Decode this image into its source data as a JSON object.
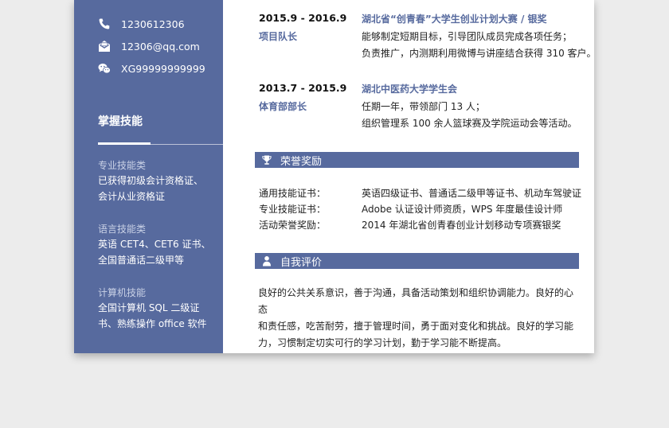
{
  "sidebar": {
    "contacts": [
      {
        "icon": "phone-icon",
        "text": "1230612306"
      },
      {
        "icon": "email-icon",
        "text": "12306@qq.com"
      },
      {
        "icon": "wechat-icon",
        "text": "XG99999999999"
      }
    ],
    "skills_title": "掌握技能",
    "skills": [
      {
        "category": "专业技能类",
        "lines": [
          "已获得初级会计资格证、",
          "会计从业资格证"
        ]
      },
      {
        "category": "语言技能类",
        "lines": [
          "英语 CET4、CET6 证书、",
          "全国普通话二级甲等"
        ]
      },
      {
        "category": "计算机技能",
        "lines": [
          "全国计算机 SQL 二级证",
          "书、熟练操作 office 软件"
        ]
      }
    ]
  },
  "experience": [
    {
      "date": "2015.9 - 2016.9",
      "role": "项目队长",
      "org": "湖北省“创青春”大学生创业计划大赛 / 银奖",
      "lines": [
        "能够制定短期目标，引导团队成员完成各项任务；",
        "负责推广，内测期利用微博与讲座结合获得 310 客户。"
      ]
    },
    {
      "date": "2013.7 - 2015.9",
      "role": "体育部部长",
      "org": "湖北中医药大学学生会",
      "lines": [
        "任期一年，带领部门 13 人；",
        "组织管理系 100 余人篮球赛及学院运动会等活动。"
      ]
    }
  ],
  "honors": {
    "title": "荣誉奖励",
    "items": [
      {
        "label": "通用技能证书：",
        "value": "英语四级证书、普通话二级甲等证书、机动车驾驶证"
      },
      {
        "label": "专业技能证书：",
        "value": "Adobe 认证设计师资质，WPS 年度最佳设计师"
      },
      {
        "label": "活动荣誉奖励：",
        "value": "2014 年湖北省创青春创业计划移动专项赛银奖"
      }
    ]
  },
  "self_eval": {
    "title": "自我评价",
    "lines": [
      "良好的公共关系意识，善于沟通，具备活动策划和组织协调能力。良好的心态",
      "和责任感，吃苦耐劳，擅于管理时间，勇于面对变化和挑战。良好的学习能",
      "力，习惯制定切实可行的学习计划，勤于学习能不断提高。"
    ]
  },
  "colors": {
    "accent": "#576a9e",
    "sidebar_bg": "#576a9e",
    "page_bg": "#ececec"
  }
}
